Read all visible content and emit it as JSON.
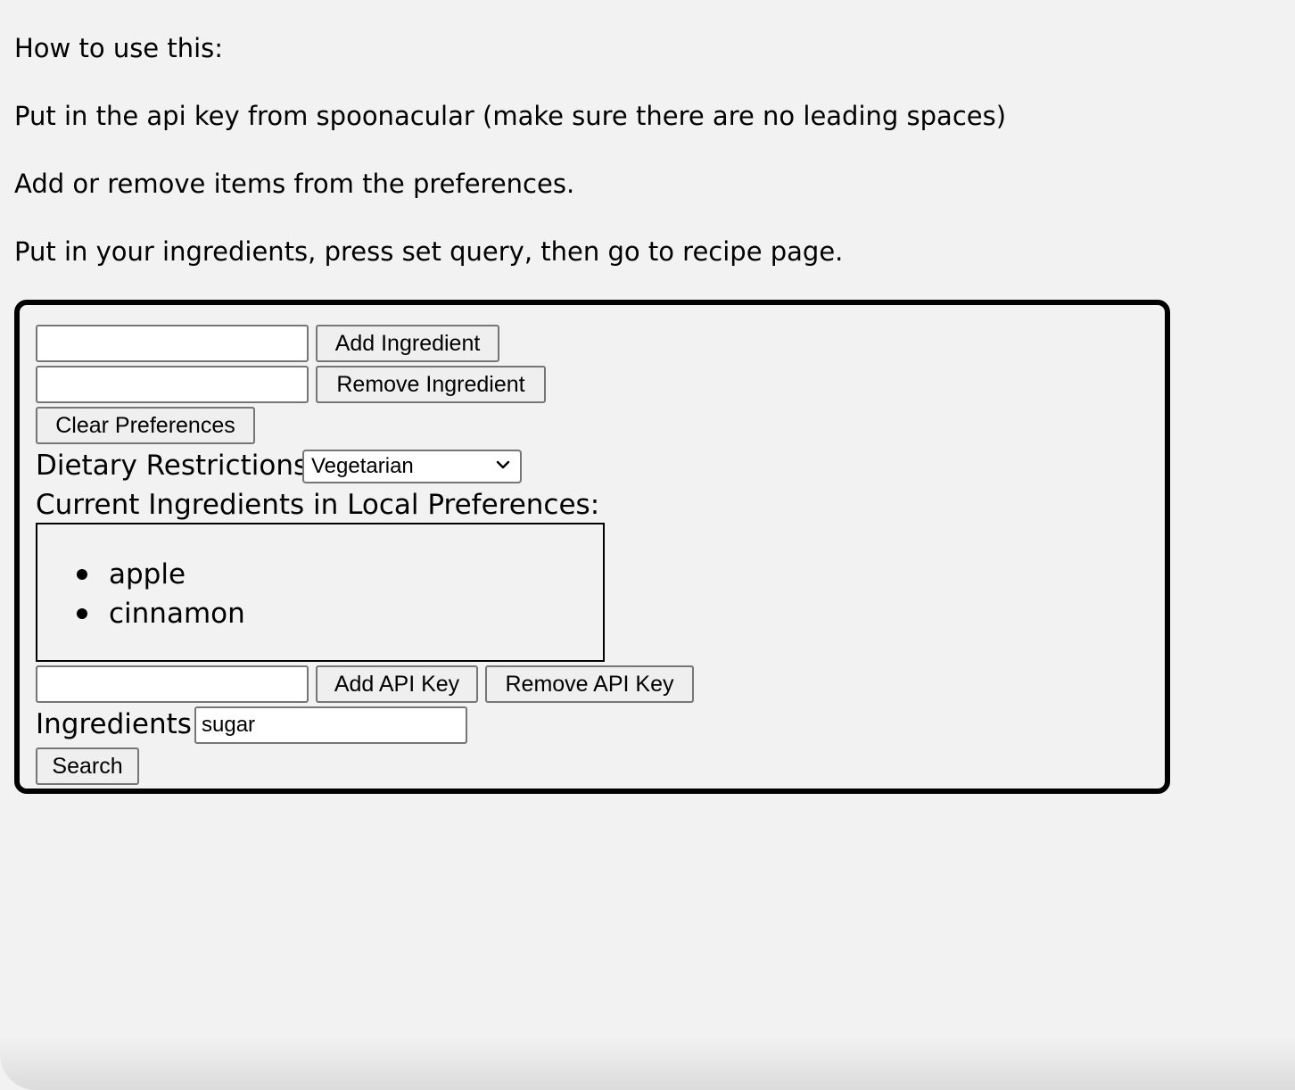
{
  "instructions": {
    "heading": "How to use this:",
    "step1": "Put in the api key from spoonacular (make sure there are no leading spaces)",
    "step2": "Add or remove items from the preferences.",
    "step3": "Put in your ingredients, press set query, then go to recipe page."
  },
  "preferences": {
    "add_ingredient_input_value": "",
    "add_ingredient_label": "Add Ingredient",
    "remove_ingredient_input_value": "",
    "remove_ingredient_label": "Remove Ingredient",
    "clear_preferences_label": "Clear Preferences",
    "dietary_label": "Dietary Restrictions",
    "dietary_selected": "Vegetarian",
    "current_heading": "Current Ingredients in Local Preferences:",
    "items": [
      "apple",
      "cinnamon"
    ]
  },
  "api_key": {
    "input_value": "",
    "add_label": "Add API Key",
    "remove_label": "Remove API Key"
  },
  "search": {
    "ingredients_label": "Ingredients",
    "ingredients_value": "sugar",
    "search_label": "Search"
  },
  "icons": {
    "select_arrow": "chevron-down-icon",
    "list_bullet": "bullet-icon"
  }
}
